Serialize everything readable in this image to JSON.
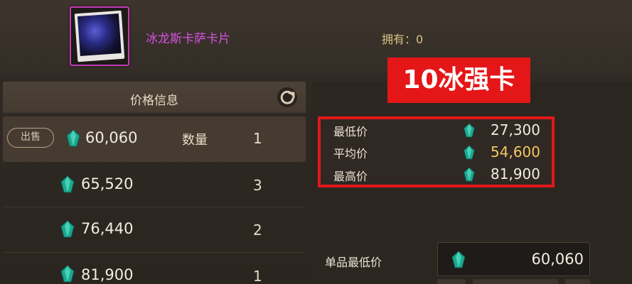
{
  "item": {
    "name": "冰龙斯卡萨卡片",
    "owned_label": "拥有：0",
    "name_color": "#d552e0"
  },
  "price_panel": {
    "title": "价格信息",
    "refresh_icon": "refresh-icon",
    "sell_label": "出售",
    "qty_label": "数量",
    "listings": [
      {
        "price": "60,060",
        "qty": "1"
      },
      {
        "price": "65,520",
        "qty": "3"
      },
      {
        "price": "76,440",
        "qty": "2"
      },
      {
        "price": "81,900",
        "qty": "1"
      }
    ]
  },
  "stats": {
    "banner": "10冰强卡",
    "min_label": "最低价",
    "min_value": "27,300",
    "avg_label": "平均价",
    "avg_value": "54,600",
    "max_label": "最高价",
    "max_value": "81,900",
    "highlight_color": "#e3171b",
    "avg_color": "#f3c764"
  },
  "purchase": {
    "unit_min_label": "单品最低价",
    "unit_min_value": "60,060"
  },
  "icons": {
    "currency": "gem-icon"
  }
}
